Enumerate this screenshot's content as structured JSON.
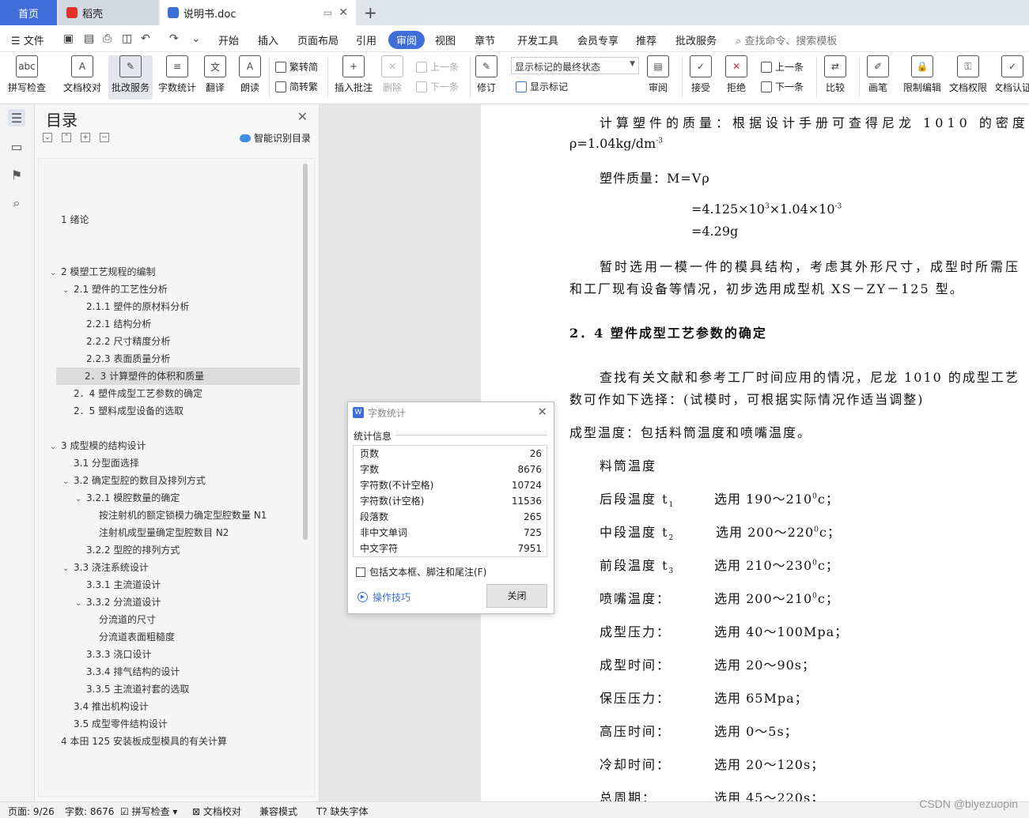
{
  "tabs": {
    "home": "首页",
    "daoke": "稻壳",
    "doc": "说明书.doc"
  },
  "menu": {
    "file": "文件",
    "items": [
      "开始",
      "插入",
      "页面布局",
      "引用",
      "审阅",
      "视图",
      "章节",
      "开发工具",
      "会员专享",
      "推荐",
      "批改服务"
    ],
    "search": "查找命令、搜索模板"
  },
  "ribbon": {
    "spell": "拼写检查",
    "proofread": "文档校对",
    "correction": "批改服务",
    "wordcount": "字数统计",
    "translate": "翻译",
    "read": "朗读",
    "trad": "繁转简",
    "simp": "简转繁",
    "insert_comment": "插入批注",
    "delete": "删除",
    "prev": "上一条",
    "next": "下一条",
    "track": "修订",
    "markup_state": "显示标记的最终状态",
    "show_markup": "显示标记",
    "review": "审阅",
    "accept": "接受",
    "reject": "拒绝",
    "prev2": "上一条",
    "next2": "下一条",
    "compare": "比较",
    "pen": "画笔",
    "restrict": "限制编辑",
    "permission": "文档权限",
    "certify": "文档认证"
  },
  "toc": {
    "title": "目录",
    "smart": "智能识别目录",
    "items": [
      {
        "text": "1  绪论",
        "level": 0,
        "caret": ""
      },
      {
        "text": "2  模塑工艺规程的编制",
        "level": 0,
        "caret": "v"
      },
      {
        "text": "2.1 塑件的工艺性分析",
        "level": 1,
        "caret": "v"
      },
      {
        "text": "2.1.1 塑件的原材料分析",
        "level": 2,
        "caret": ""
      },
      {
        "text": "2.2.1 结构分析",
        "level": 2,
        "caret": ""
      },
      {
        "text": "2.2.2 尺寸精度分析",
        "level": 2,
        "caret": ""
      },
      {
        "text": "2.2.3 表面质量分析",
        "level": 2,
        "caret": ""
      },
      {
        "text": "2．3 计算塑件的体积和质量",
        "level": 1,
        "caret": "",
        "selected": true
      },
      {
        "text": "2．4 塑件成型工艺参数的确定",
        "level": 1,
        "caret": ""
      },
      {
        "text": "2．5 塑料成型设备的选取",
        "level": 1,
        "caret": ""
      },
      {
        "text": "3  成型模的结构设计",
        "level": 0,
        "caret": "v"
      },
      {
        "text": "3.1 分型面选择",
        "level": 1,
        "caret": ""
      },
      {
        "text": "3.2 确定型腔的数目及排列方式",
        "level": 1,
        "caret": "v"
      },
      {
        "text": "3.2.1 模腔数量的确定",
        "level": 2,
        "caret": "v"
      },
      {
        "text": "按注射机的额定锁模力确定型腔数量 N1",
        "level": 3,
        "caret": ""
      },
      {
        "text": "注射机成型量确定型腔数目 N2",
        "level": 3,
        "caret": ""
      },
      {
        "text": "3.2.2 型腔的排列方式",
        "level": 2,
        "caret": ""
      },
      {
        "text": "3.3 浇注系统设计",
        "level": 1,
        "caret": "v"
      },
      {
        "text": "3.3.1   主流道设计",
        "level": 2,
        "caret": ""
      },
      {
        "text": "3.3.2 分流道设计",
        "level": 2,
        "caret": "v"
      },
      {
        "text": "分流道的尺寸",
        "level": 3,
        "caret": ""
      },
      {
        "text": "分流道表面粗糙度",
        "level": 3,
        "caret": ""
      },
      {
        "text": "3.3.3 浇口设计",
        "level": 2,
        "caret": ""
      },
      {
        "text": "3.3.4 排气结构的设计",
        "level": 2,
        "caret": ""
      },
      {
        "text": "3.3.5 主流道衬套的选取",
        "level": 2,
        "caret": ""
      },
      {
        "text": "3.4 推出机构设计",
        "level": 1,
        "caret": ""
      },
      {
        "text": "3.5 成型零件结构设计",
        "level": 1,
        "caret": ""
      },
      {
        "text": "4  本田 125 安装板成型模具的有关计算",
        "level": 0,
        "caret": ""
      }
    ]
  },
  "doc": {
    "p1a": "计算塑件的质量：根据设计手册可查得尼龙 1010 的密度",
    "p1b": "ρ=1.04kg/dm",
    "p1b_sup": "-3",
    "p2": "塑件质量：M=Vρ",
    "p3a": "=4.125×10",
    "p3a_sup1": "3",
    "p3a_mid": "×1.04×10",
    "p3a_sup2": "-3",
    "p3b": "=4.29g",
    "p4a": "暂时选用一模一件的模具结构，考虑其外形尺寸，成型时所需压",
    "p4b": "和工厂现有设备等情况，初步选用成型机 XS－ZY－125 型。",
    "h24": "2．4 塑件成型工艺参数的确定",
    "p5a": "查找有关文献和参考工厂时间应用的情况，尼龙 1010 的成型工艺",
    "p5b": "数可作如下选择：(试模时，可根据实际情况作适当调整)",
    "p6": "成型温度：包括料筒温度和喷嘴温度。",
    "p7": "料筒温度",
    "rows": [
      {
        "label": "后段温度 t",
        "sub": "1",
        "value": "选用 190～210",
        "unit_sup": "0",
        "unit": "c；"
      },
      {
        "label": "中段温度 t",
        "sub": "2",
        "value": "选用 200～220",
        "unit_sup": "0",
        "unit": "c；"
      },
      {
        "label": "前段温度 t",
        "sub": "3",
        "value": "选用 210～230",
        "unit_sup": "0",
        "unit": "c；"
      },
      {
        "label": "喷嘴温度：",
        "sub": "",
        "value": "选用 200～210",
        "unit_sup": "0",
        "unit": "c；"
      },
      {
        "label": "成型压力：",
        "sub": "",
        "value": "选用 40～100Mpa；",
        "unit_sup": "",
        "unit": ""
      },
      {
        "label": "成型时间：",
        "sub": "",
        "value": "选用 20～90s；",
        "unit_sup": "",
        "unit": ""
      },
      {
        "label": "保压压力：",
        "sub": "",
        "value": "选用  65Mpa；",
        "unit_sup": "",
        "unit": ""
      },
      {
        "label": "高压时间：",
        "sub": "",
        "value": "选用 0～5s；",
        "unit_sup": "",
        "unit": ""
      },
      {
        "label": "冷却时间：",
        "sub": "",
        "value": "选用 20～120s；",
        "unit_sup": "",
        "unit": ""
      },
      {
        "label": "总周期：",
        "sub": "",
        "value": "选用 45～220s；",
        "unit_sup": "",
        "unit": ""
      }
    ]
  },
  "dialog": {
    "title": "字数统计",
    "group": "统计信息",
    "stats": [
      {
        "label": "页数",
        "value": "26"
      },
      {
        "label": "字数",
        "value": "8676"
      },
      {
        "label": "字符数(不计空格)",
        "value": "10724"
      },
      {
        "label": "字符数(计空格)",
        "value": "11536"
      },
      {
        "label": "段落数",
        "value": "265"
      },
      {
        "label": "非中文单词",
        "value": "725"
      },
      {
        "label": "中文字符",
        "value": "7951"
      }
    ],
    "checkbox": "包括文本框、脚注和尾注(F)",
    "tips": "操作技巧",
    "close": "关闭"
  },
  "status": {
    "page": "页面: 9/26",
    "words": "字数: 8676",
    "spell": "拼写检查",
    "proof": "文档校对",
    "compat": "兼容模式",
    "font": "缺失字体"
  },
  "watermark": "CSDN @biyezuopin",
  "colors": {
    "accent": "#3f6ed8"
  }
}
